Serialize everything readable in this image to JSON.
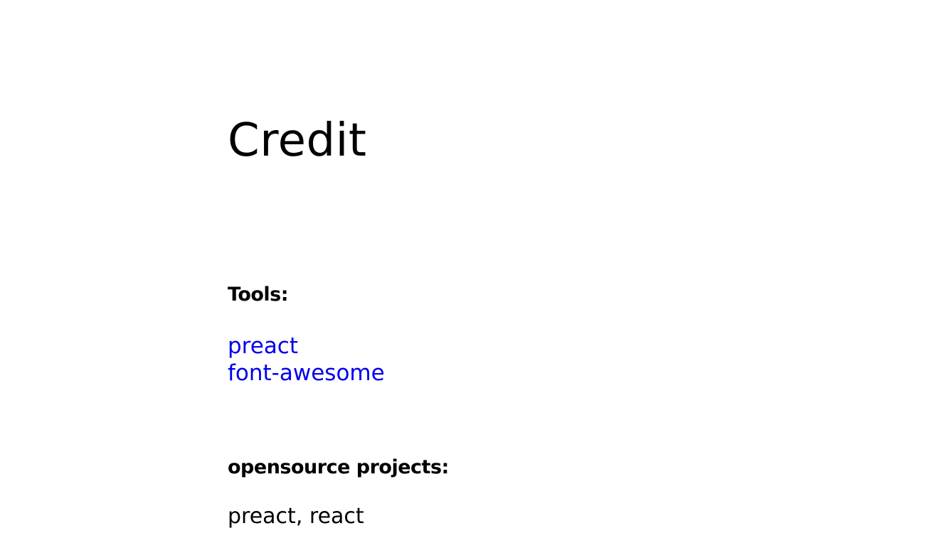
{
  "page": {
    "title": "Credit",
    "tools": {
      "heading": "Tools:",
      "links": [
        "preact",
        "font-awesome"
      ]
    },
    "opensource": {
      "heading": "opensource projects:",
      "text": "preact, react"
    },
    "colors": {
      "link": "#0000ee",
      "text": "#000000",
      "background": "#ffffff"
    }
  }
}
